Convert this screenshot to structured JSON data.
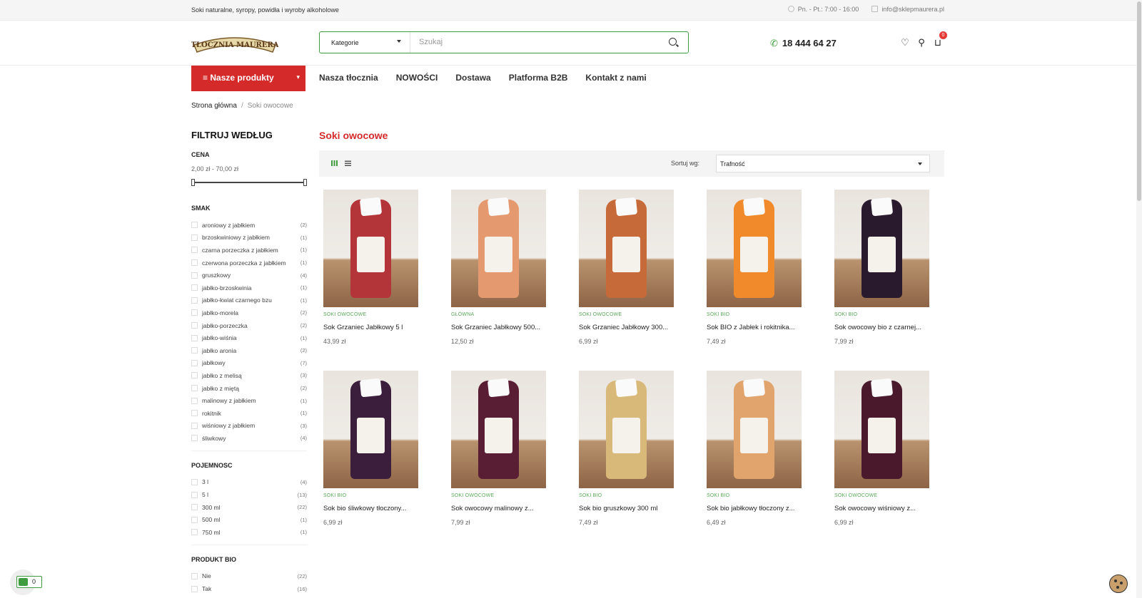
{
  "topbar": {
    "tagline": "Soki naturalne, syropy, powidła i wyroby alkoholowe",
    "hours": "Pn. - Pt.: 7:00 - 16:00",
    "email": "info@sklepmaurera.pl"
  },
  "header": {
    "logo_text": "TŁOCZNIA MAURERA",
    "category_label": "Kategorie",
    "search_placeholder": "Szukaj",
    "phone": "18 444 64 27",
    "cart_count": "0"
  },
  "nav": {
    "products_label": "Nasze produkty",
    "links": [
      "Nasza tłocznia",
      "NOWOŚCI",
      "Dostawa",
      "Platforma B2B",
      "Kontakt z nami"
    ]
  },
  "breadcrumb": {
    "home": "Strona główna",
    "current": "Soki owocowe"
  },
  "filters": {
    "title": "FILTRUJ WEDŁUG",
    "price_title": "CENA",
    "price_range": "2,00 zł - 70,00 zł",
    "smak_title": "SMAK",
    "smak": [
      {
        "label": "aroniowy z jabłkiem",
        "count": "(2)"
      },
      {
        "label": "brzoskwiniowy z jabłkiem",
        "count": "(1)"
      },
      {
        "label": "czarna porzeczka z jabłkiem",
        "count": "(1)"
      },
      {
        "label": "czerwona porzeczka z jabłkiem",
        "count": "(1)"
      },
      {
        "label": "gruszkowy",
        "count": "(4)"
      },
      {
        "label": "jabłko-brzoskwinia",
        "count": "(1)"
      },
      {
        "label": "jabłko-kwiat czarnego bzu",
        "count": "(1)"
      },
      {
        "label": "jabłko-morela",
        "count": "(2)"
      },
      {
        "label": "jabłko-porzeczka",
        "count": "(2)"
      },
      {
        "label": "jabłko-wiśnia",
        "count": "(1)"
      },
      {
        "label": "jabłko aronia",
        "count": "(2)"
      },
      {
        "label": "jabłkowy",
        "count": "(7)"
      },
      {
        "label": "jabłko z melisą",
        "count": "(3)"
      },
      {
        "label": "jabłko z miętą",
        "count": "(2)"
      },
      {
        "label": "malinowy z jabłkiem",
        "count": "(1)"
      },
      {
        "label": "rokitnik",
        "count": "(1)"
      },
      {
        "label": "wiśniowy z jabłkiem",
        "count": "(3)"
      },
      {
        "label": "śliwkowy",
        "count": "(4)"
      }
    ],
    "pojemnosc_title": "POJEMNOSC",
    "pojemnosc": [
      {
        "label": "3 l",
        "count": "(4)"
      },
      {
        "label": "5 l",
        "count": "(13)"
      },
      {
        "label": "300 ml",
        "count": "(22)"
      },
      {
        "label": "500 ml",
        "count": "(1)"
      },
      {
        "label": "750 ml",
        "count": "(1)"
      }
    ],
    "bio_title": "PRODUKT BIO",
    "bio": [
      {
        "label": "Nie",
        "count": "(22)"
      },
      {
        "label": "Tak",
        "count": "(16)"
      }
    ]
  },
  "listing": {
    "title": "Soki owocowe",
    "sort_label": "Sortuj wg:",
    "sort_value": "Trafność"
  },
  "products": [
    {
      "cat": "SOKI OWOCOWE",
      "name": "Sok Grzaniec Jabłkowy 5 l",
      "price": "43,99 zł",
      "color": "#b3353a"
    },
    {
      "cat": "GŁÓWNA",
      "name": "Sok Grzaniec Jabłkowy 500...",
      "price": "12,50 zł",
      "color": "#e49a6e"
    },
    {
      "cat": "SOKI OWOCOWE",
      "name": "Sok Grzaniec Jabłkowy 300...",
      "price": "6,99 zł",
      "color": "#c76a3a"
    },
    {
      "cat": "SOKI BIO",
      "name": "Sok BIO z Jabłek i rokitnika...",
      "price": "7,49 zł",
      "color": "#f08a2a"
    },
    {
      "cat": "SOKI BIO",
      "name": "Sok owocowy bio z czarnej...",
      "price": "7,99 zł",
      "color": "#2a1a2e"
    },
    {
      "cat": "SOKI BIO",
      "name": "Sok bio śliwkowy tłoczony...",
      "price": "6,99 zł",
      "color": "#3a1e3c"
    },
    {
      "cat": "SOKI OWOCOWE",
      "name": "Sok owocowy malinowy z...",
      "price": "7,99 zł",
      "color": "#5a1e34"
    },
    {
      "cat": "SOKI BIO",
      "name": "Sok bio gruszkowy 300 ml",
      "price": "7,49 zł",
      "color": "#d9b97a"
    },
    {
      "cat": "SOKI BIO",
      "name": "Sok bio jabłkowy tłoczony z...",
      "price": "6,49 zł",
      "color": "#e0a46c"
    },
    {
      "cat": "SOKI OWOCOWE",
      "name": "Sok owocowy wiśniowy z...",
      "price": "6,99 zł",
      "color": "#4a1a2c"
    }
  ],
  "cookie_count": "0"
}
